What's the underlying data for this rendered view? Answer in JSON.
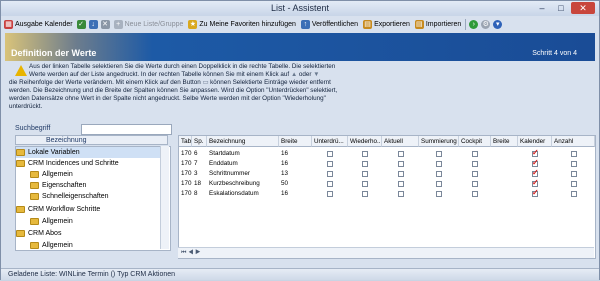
{
  "window": {
    "title": "List - Assistent"
  },
  "toolbar": {
    "ausgabe_kalender": "Ausgabe Kalender",
    "neue_liste": "Neue Liste/Gruppe",
    "favoriten": "Zu Meine Favoriten hinzufügen",
    "veroeffentlichen": "Veröffentlichen",
    "exportieren": "Exportieren",
    "importieren": "Importieren"
  },
  "banner": {
    "title": "Definition der Werte",
    "step": "Schritt 4 von 4"
  },
  "instructions": {
    "line1": "Aus der linken Tabelle selektieren Sie die Werte durch einen Doppelklick in die rechte Tabelle. Die selektierten",
    "line2": "Werte werden auf der Liste angedruckt. In der rechten Tabelle können Sie mit einem Klick auf",
    "line2b": "oder",
    "line3": "die Reihenfolge der Werte verändern. Mit einem Klick auf den Button",
    "line3b": "können Selektierte Einträge wieder entfernt",
    "line4": "werden. Die Bezeichnung und die Breite der Spalten können Sie anpassen. Wird die Option \"Unterdrücken\" selektiert,",
    "line5": "werden Datensätze ohne Wert in der Spalte nicht angedruckt. Selbe Werte werden mit der Option \"Wiederholung\"",
    "line6": "unterdrückt."
  },
  "search": {
    "label": "Suchbegriff",
    "value": ""
  },
  "tree": {
    "header": "Bezeichnung",
    "items": [
      {
        "label": "Lokale Variablen",
        "level": 0,
        "selected": true
      },
      {
        "label": "CRM Incidences und Schritte",
        "level": 0,
        "selected": false
      },
      {
        "label": "Allgemein",
        "level": 1,
        "selected": false
      },
      {
        "label": "Eigenschaften",
        "level": 1,
        "selected": false
      },
      {
        "label": "Schnelleigenschaften",
        "level": 1,
        "selected": false
      },
      {
        "label": "CRM Workflow Schritte",
        "level": 0,
        "selected": false
      },
      {
        "label": "Allgemein",
        "level": 1,
        "selected": false
      },
      {
        "label": "CRM Abos",
        "level": 0,
        "selected": false
      },
      {
        "label": "Allgemein",
        "level": 1,
        "selected": false
      }
    ]
  },
  "grid": {
    "columns": [
      "Tab.",
      "Sp.",
      "Bezeichnung",
      "Breite",
      "Unterdrü...",
      "Wiederho...",
      "Aktuell",
      "Summierung",
      "Cockpit",
      "Breite",
      "Kalender",
      "Anzahl"
    ],
    "rows": [
      {
        "tab": "170",
        "sp": "6",
        "bez": "Startdatum",
        "breite": "16",
        "kalender": true
      },
      {
        "tab": "170",
        "sp": "7",
        "bez": "Enddatum",
        "breite": "16",
        "kalender": true
      },
      {
        "tab": "170",
        "sp": "3",
        "bez": "Schrittnummer",
        "breite": "13",
        "kalender": true
      },
      {
        "tab": "170",
        "sp": "18",
        "bez": "Kurzbeschreibung",
        "breite": "50",
        "kalender": true
      },
      {
        "tab": "170",
        "sp": "8",
        "bez": "Eskalationsdatum",
        "breite": "16",
        "kalender": true
      }
    ]
  },
  "status": {
    "text": "Geladene Liste: WINLine Termin () Typ CRM Aktionen"
  },
  "colors": {
    "accent": "#1a4c96",
    "check": "#d21c1c"
  }
}
